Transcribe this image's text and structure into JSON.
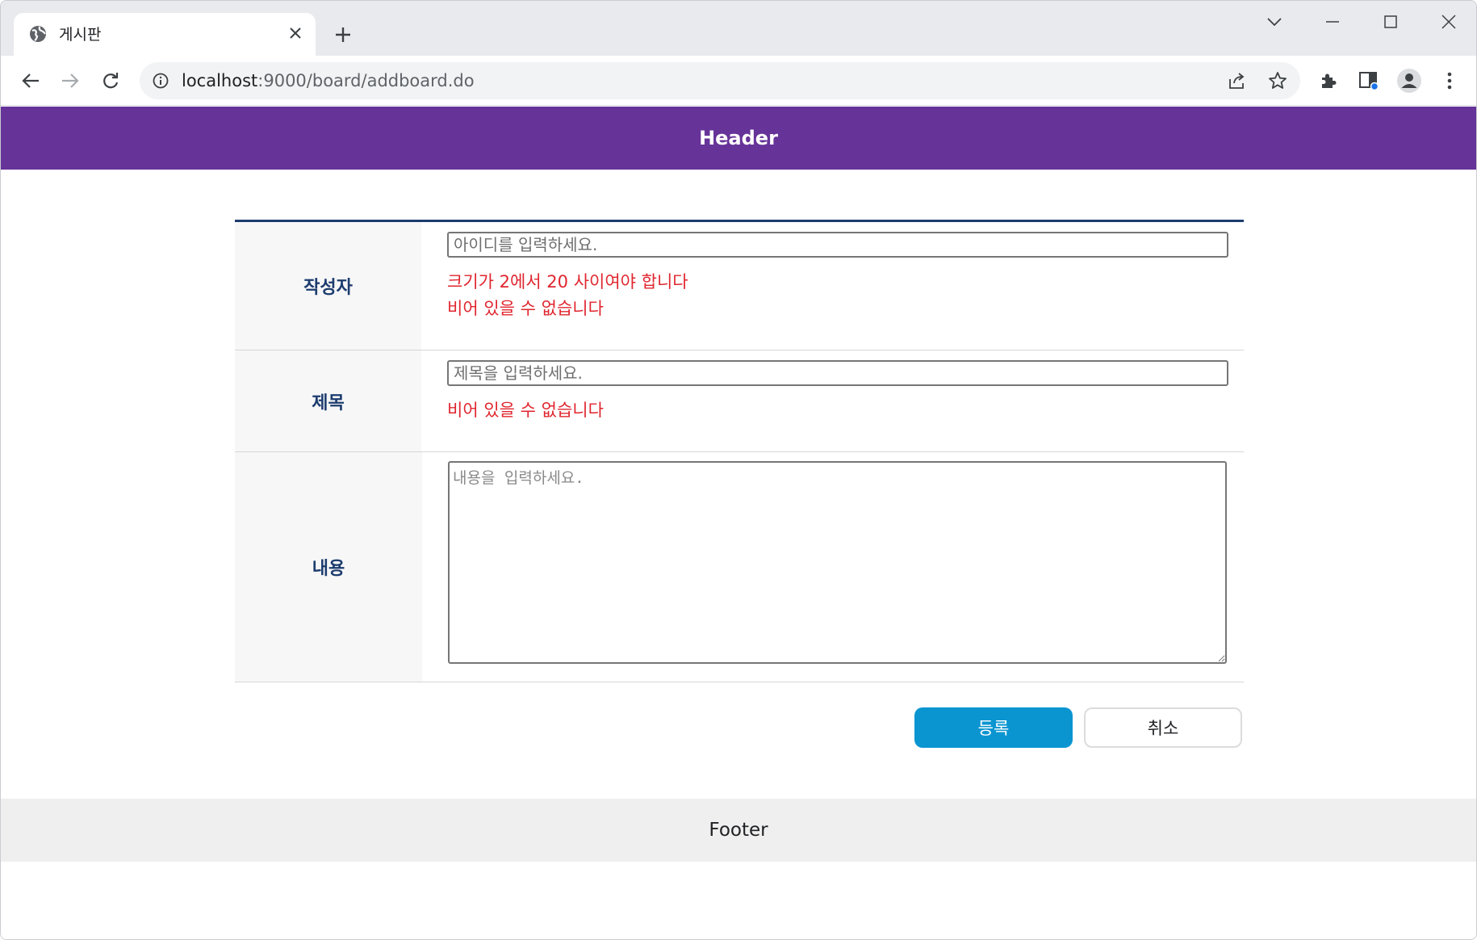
{
  "browser": {
    "tab_title": "게시판",
    "url_host": "localhost",
    "url_path": ":9000/board/addboard.do"
  },
  "page": {
    "header": "Header",
    "footer": "Footer",
    "form": {
      "writer": {
        "label": "작성자",
        "placeholder": "아이디를 입력하세요.",
        "value": "",
        "errors": [
          "크기가 2에서 20 사이여야 합니다",
          "비어 있을 수 없습니다"
        ]
      },
      "title": {
        "label": "제목",
        "placeholder": "제목을 입력하세요.",
        "value": "",
        "errors": [
          "비어 있을 수 없습니다"
        ]
      },
      "content": {
        "label": "내용",
        "placeholder": "내용을 입력하세요.",
        "value": ""
      }
    },
    "buttons": {
      "submit": "등록",
      "cancel": "취소"
    }
  },
  "colors": {
    "header_bg": "#663399",
    "label_text": "#1d3c6e",
    "error_text": "#e0262f",
    "submit_bg": "#0a95d1",
    "footer_bg": "#efefef"
  },
  "icons": [
    "globe-favicon-icon",
    "close-icon",
    "plus-icon",
    "chevron-down-icon",
    "minimize-icon",
    "maximize-icon",
    "close-window-icon",
    "back-arrow-icon",
    "forward-arrow-icon",
    "reload-icon",
    "info-icon",
    "share-icon",
    "star-icon",
    "extensions-icon",
    "side-panel-icon",
    "profile-icon",
    "kebab-menu-icon"
  ]
}
